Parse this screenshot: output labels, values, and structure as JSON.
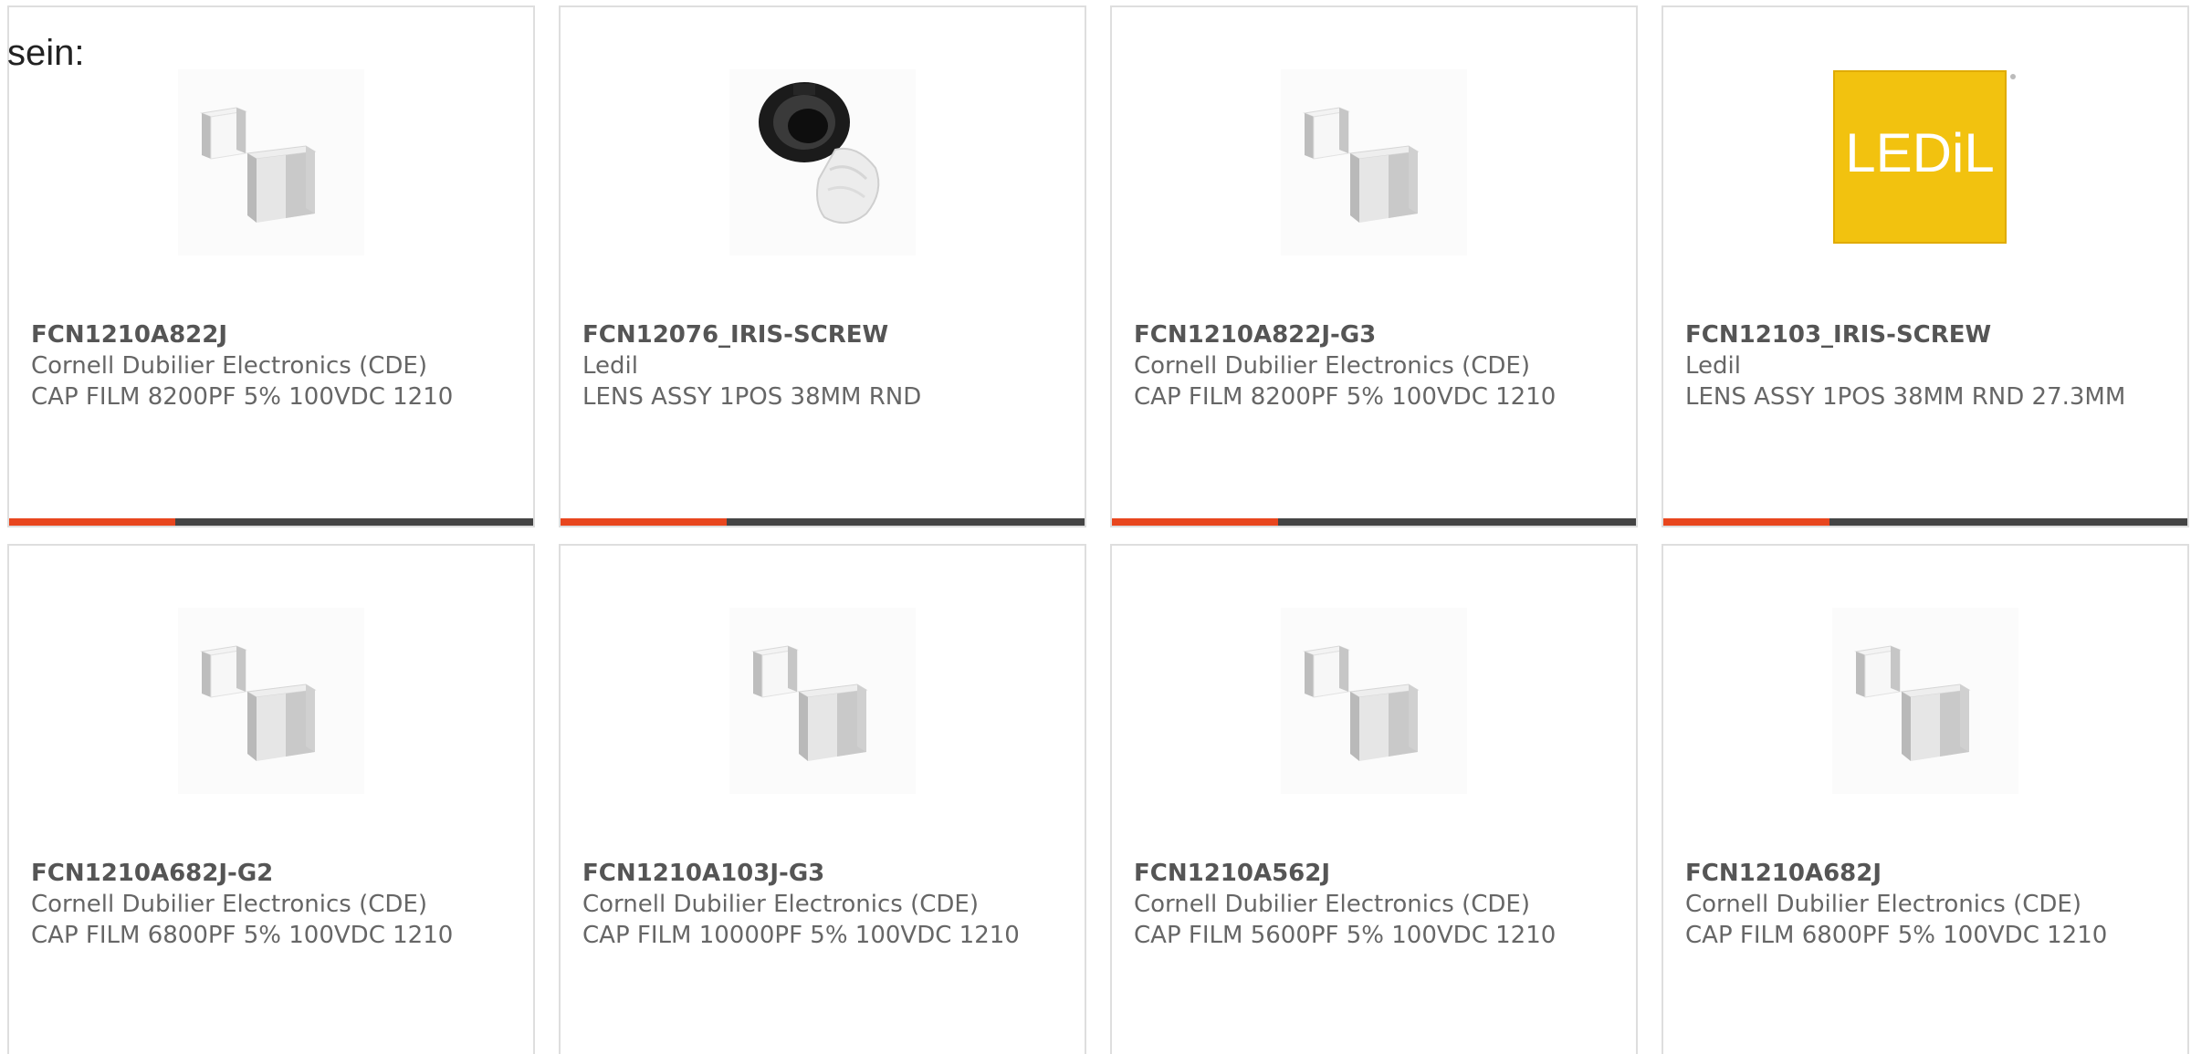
{
  "intro_text": "sein:",
  "colors": {
    "accent": "#e8461e",
    "bar": "#444444",
    "border": "#dedede",
    "ledil_yellow": "#f2c20f"
  },
  "products": [
    {
      "part_number": "FCN1210A822J",
      "manufacturer": "Cornell Dubilier Electronics (CDE)",
      "description": "CAP FILM 8200PF 5% 100VDC 1210",
      "image_icon": "capacitor-icon"
    },
    {
      "part_number": "FCN12076_IRIS-SCREW",
      "manufacturer": "Ledil",
      "description": "LENS ASSY 1POS 38MM RND",
      "image_icon": "lens-holder-icon"
    },
    {
      "part_number": "FCN1210A822J-G3",
      "manufacturer": "Cornell Dubilier Electronics (CDE)",
      "description": "CAP FILM 8200PF 5% 100VDC 1210",
      "image_icon": "capacitor-icon"
    },
    {
      "part_number": "FCN12103_IRIS-SCREW",
      "manufacturer": "Ledil",
      "description": "LENS ASSY 1POS 38MM RND 27.3MM",
      "image_icon": "ledil-logo",
      "logo_text": "LEDiL"
    },
    {
      "part_number": "FCN1210A682J-G2",
      "manufacturer": "Cornell Dubilier Electronics (CDE)",
      "description": "CAP FILM 6800PF 5% 100VDC 1210",
      "image_icon": "capacitor-icon"
    },
    {
      "part_number": "FCN1210A103J-G3",
      "manufacturer": "Cornell Dubilier Electronics (CDE)",
      "description": "CAP FILM 10000PF 5% 100VDC 1210",
      "image_icon": "capacitor-icon"
    },
    {
      "part_number": "FCN1210A562J",
      "manufacturer": "Cornell Dubilier Electronics (CDE)",
      "description": "CAP FILM 5600PF 5% 100VDC 1210",
      "image_icon": "capacitor-icon"
    },
    {
      "part_number": "FCN1210A682J",
      "manufacturer": "Cornell Dubilier Electronics (CDE)",
      "description": "CAP FILM 6800PF 5% 100VDC 1210",
      "image_icon": "capacitor-icon"
    }
  ]
}
